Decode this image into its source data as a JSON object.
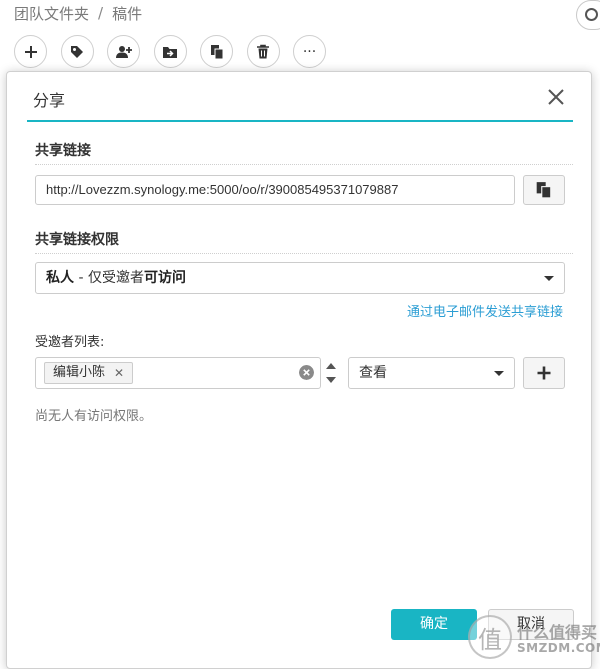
{
  "breadcrumb": {
    "parent": "团队文件夹",
    "separator": "/",
    "current": "稿件"
  },
  "toolbar": {
    "buttons": [
      "plus-icon",
      "tag-icon",
      "add-user-icon",
      "move-icon",
      "copy-icon",
      "trash-icon",
      "more-icon"
    ],
    "more_label": "···"
  },
  "modal": {
    "title": "分享",
    "link_section_title": "共享链接",
    "share_link": "http://Lovezzm.synology.me:5000/oo/r/390085495371079887",
    "permission_section_title": "共享链接权限",
    "permission": {
      "prefix": "私人",
      "middle": " - 仅受邀者",
      "suffix": "可访问"
    },
    "email_link": "通过电子邮件发送共享链接",
    "invitee_label": "受邀者列表:",
    "invitee_tag": "编辑小陈",
    "tag_remove": "✕",
    "view_option": "查看",
    "empty_note": "尚无人有访问权限。",
    "ok_label": "确定",
    "cancel_label": "取消"
  },
  "watermark": {
    "glyph": "值",
    "cn": "什么值得买",
    "en": "SMZDM.COM"
  },
  "colors": {
    "accent": "#19b5c4",
    "link": "#2c9ed4"
  }
}
